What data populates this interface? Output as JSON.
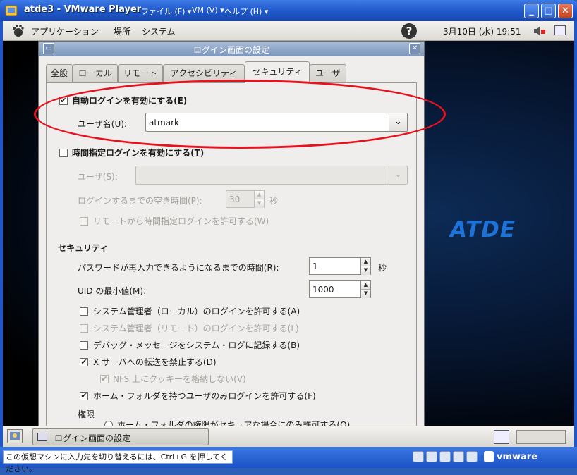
{
  "vmware": {
    "title": "atde3 - VMware Player",
    "menus": [
      "ファイル (F) ▾",
      "VM (V) ▾",
      "ヘルプ (H) ▾"
    ],
    "status_text": "この仮想マシンに入力先を切り替えるには、Ctrl+G を押してください。",
    "brand": "vmware"
  },
  "gnome_panel": {
    "menus": [
      "アプリケーション",
      "場所",
      "システム"
    ],
    "clock": "3月10日 (水) 19:51"
  },
  "desktop": {
    "logo_text": "ATDE"
  },
  "dialog": {
    "title": "ログイン画面の設定",
    "tabs": [
      "全般",
      "ローカル",
      "リモート",
      "アクセシビリティ",
      "セキュリティ",
      "ユーザ"
    ],
    "active_tab": "セキュリティ",
    "auto_login": {
      "label": "自動ログインを有効にする(E)",
      "checked": true,
      "user_label": "ユーザ名(U):",
      "user_value": "atmark"
    },
    "timed_login": {
      "label": "時間指定ログインを有効にする(T)",
      "checked": false,
      "user_label": "ユーザ(S):",
      "user_value": "",
      "delay_label": "ログインするまでの空き時間(P):",
      "delay_value": "30",
      "delay_unit": "秒",
      "remote_label": "リモートから時間指定ログインを許可する(W)"
    },
    "security": {
      "heading": "セキュリティ",
      "retry_label": "パスワードが再入力できるようになるまでの時間(R):",
      "retry_value": "1",
      "retry_unit": "秒",
      "uid_label": "UID の最小値(M):",
      "uid_value": "1000",
      "options": [
        {
          "label": "システム管理者（ローカル）のログインを許可する(A)",
          "checked": false,
          "enabled": true
        },
        {
          "label": "システム管理者（リモート）のログインを許可する(L)",
          "checked": false,
          "enabled": false
        },
        {
          "label": "デバッグ・メッセージをシステム・ログに記録する(B)",
          "checked": false,
          "enabled": true
        },
        {
          "label": "X サーバへの転送を禁止する(D)",
          "checked": true,
          "enabled": true
        },
        {
          "label": "NFS 上にクッキーを格納しない(V)",
          "checked": true,
          "enabled": false
        },
        {
          "label": "ホーム・フォルダを持つユーザのみログインを許可する(F)",
          "checked": true,
          "enabled": true
        }
      ],
      "perm_heading": "権限",
      "perm_option": "ホーム・フォルダの権限がセキュアな場合にのみ許可する(O)"
    }
  },
  "taskbar": {
    "task_label": "ログイン画面の設定"
  }
}
